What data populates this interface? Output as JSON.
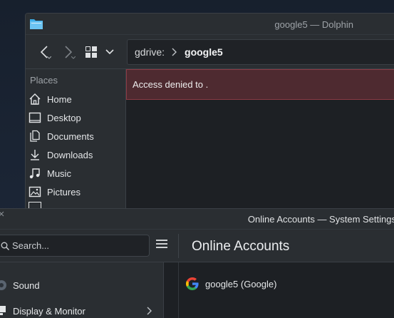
{
  "dolphin": {
    "title": "google5 — Dolphin",
    "breadcrumb": {
      "root": "gdrive:",
      "current": "google5"
    },
    "places": {
      "header": "Places",
      "items": [
        {
          "label": "Home",
          "icon": "home-icon"
        },
        {
          "label": "Desktop",
          "icon": "desktop-icon"
        },
        {
          "label": "Documents",
          "icon": "documents-icon"
        },
        {
          "label": "Downloads",
          "icon": "downloads-icon"
        },
        {
          "label": "Music",
          "icon": "music-icon"
        },
        {
          "label": "Pictures",
          "icon": "pictures-icon"
        }
      ]
    },
    "error_message": "Access denied to ."
  },
  "settings": {
    "title": "Online Accounts — System Settings",
    "search": {
      "placeholder": "Search..."
    },
    "page_title": "Online Accounts",
    "sidebar": {
      "items": [
        {
          "label": "Sound",
          "icon": "sound-icon"
        },
        {
          "label": "Display & Monitor",
          "icon": "display-icon"
        }
      ]
    },
    "accounts": [
      {
        "label": "google5 (Google)",
        "icon": "google-icon"
      }
    ]
  },
  "colors": {
    "error_bg": "#4e2a30",
    "error_border": "#8a3a44",
    "window_bg": "#202326",
    "panel_bg": "#2a2e32"
  }
}
